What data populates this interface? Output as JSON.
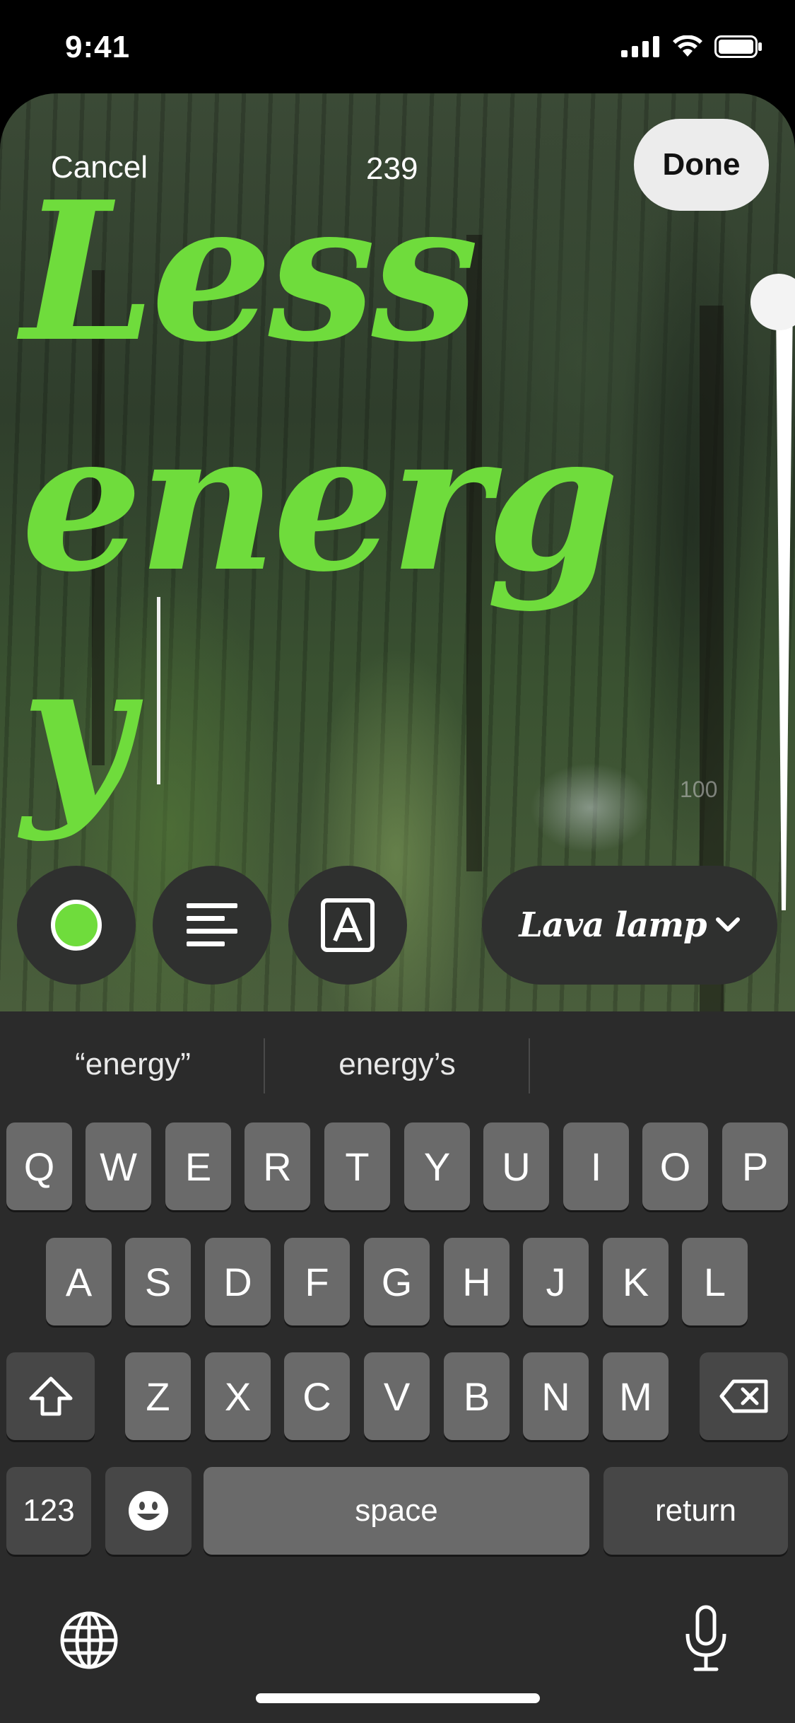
{
  "status": {
    "time": "9:41"
  },
  "editor": {
    "cancel_label": "Cancel",
    "char_count": "239",
    "done_label": "Done",
    "text_lines": [
      "Less",
      "energ",
      "y"
    ],
    "text_color": "#6fdc3c",
    "size_slider_label": "100"
  },
  "tools": {
    "color_icon": "green-color-swatch-icon",
    "align_icon": "align-left-icon",
    "style_icon": "text-background-icon",
    "font_label": "Lava lamp",
    "font_dropdown_icon": "chevron-down-icon"
  },
  "suggestions": [
    "“energy”",
    "energy’s",
    ""
  ],
  "keyboard": {
    "row1": [
      "Q",
      "W",
      "E",
      "R",
      "T",
      "Y",
      "U",
      "I",
      "O",
      "P"
    ],
    "row2": [
      "A",
      "S",
      "D",
      "F",
      "G",
      "H",
      "J",
      "K",
      "L"
    ],
    "row3": [
      "Z",
      "X",
      "C",
      "V",
      "B",
      "N",
      "M"
    ],
    "numbers_label": "123",
    "space_label": "space",
    "return_label": "return",
    "shift_icon": "shift-icon",
    "delete_icon": "delete-icon",
    "emoji_icon": "emoji-icon",
    "globe_icon": "globe-icon",
    "mic_icon": "microphone-icon"
  }
}
